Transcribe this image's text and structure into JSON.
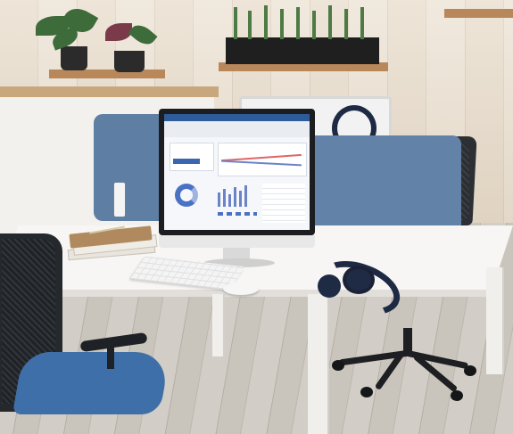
{
  "scene": {
    "description_label": "",
    "colors": {
      "wall_panels": "#e8dccb",
      "floor_wood": "#c9c4bc",
      "desk_white": "#f7f6f4",
      "divider_panel_blue": "#6382a8",
      "chair_seat_blue": "#3f6fa8",
      "chair_mesh_black": "#25282c",
      "monitor_bezel": "#1b1d21",
      "headphones_navy": "#1e2a44",
      "plant_green": "#3d6b3a"
    }
  }
}
